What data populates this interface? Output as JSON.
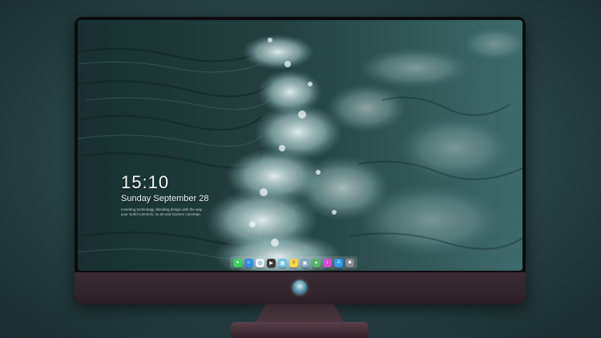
{
  "lockscreen": {
    "time": "15:10",
    "date": "Sunday September 28",
    "fine_print": "Inventing technology, blending design with the way your world connects, so art and science converge."
  },
  "dock": {
    "items": [
      {
        "name": "messages",
        "icon": "messages-icon",
        "color": "#3ecf5e",
        "glyph": "●"
      },
      {
        "name": "finder",
        "icon": "finder-icon",
        "color": "#2d8ee6",
        "glyph": "☺"
      },
      {
        "name": "safari",
        "icon": "safari-icon",
        "color": "#e8eef2",
        "glyph": "◎"
      },
      {
        "name": "video",
        "icon": "video-icon",
        "color": "#3a3a3a",
        "glyph": "▶"
      },
      {
        "name": "clips",
        "icon": "clips-icon",
        "color": "#6ec3e8",
        "glyph": "▦"
      },
      {
        "name": "notes",
        "icon": "notes-icon",
        "color": "#f4d54a",
        "glyph": "≡"
      },
      {
        "name": "preview",
        "icon": "preview-icon",
        "color": "#7da7c9",
        "glyph": "▣"
      },
      {
        "name": "maps",
        "icon": "maps-icon",
        "color": "#58b36a",
        "glyph": "✦"
      },
      {
        "name": "itunes",
        "icon": "music-icon",
        "color": "#d94ad0",
        "glyph": "♪"
      },
      {
        "name": "app-store",
        "icon": "app-store-icon",
        "color": "#2d9bf0",
        "glyph": "A"
      },
      {
        "name": "camera",
        "icon": "camera-icon",
        "color": "#8a8a8a",
        "glyph": "◙"
      }
    ]
  },
  "colors": {
    "wave_foam": "#dfeaea",
    "sea_dark": "#1d3536",
    "monitor_chin": "#3b2c33"
  }
}
